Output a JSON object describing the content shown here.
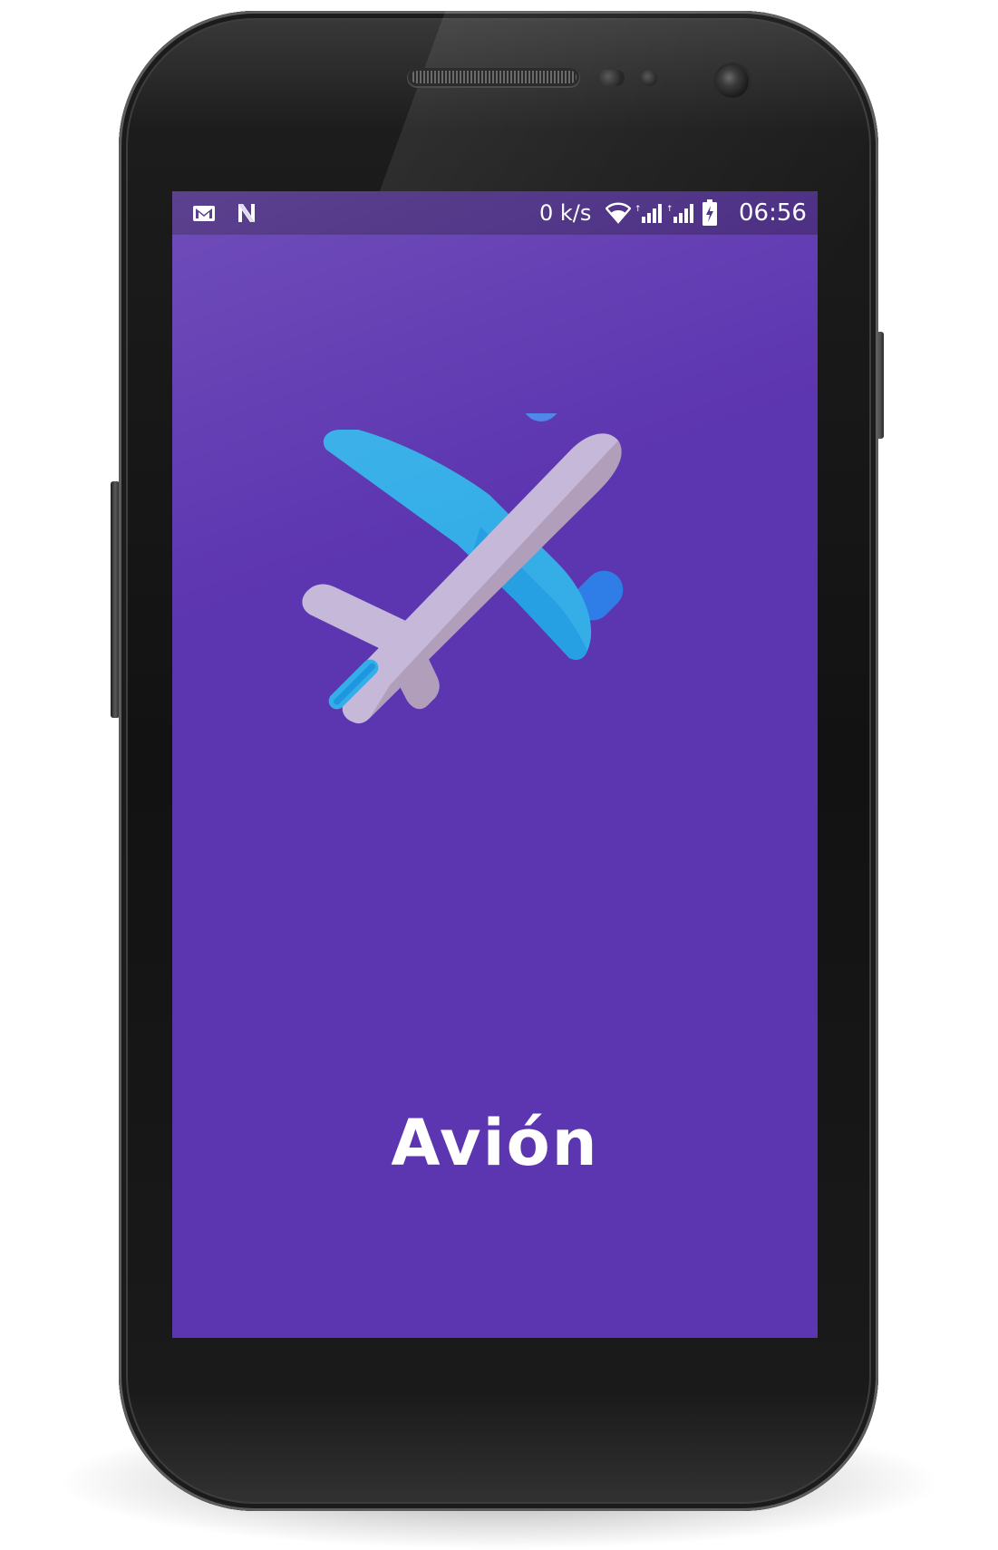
{
  "status_bar": {
    "notification_icons": [
      "gmail-icon",
      "n-icon"
    ],
    "network_speed": "0 k/s",
    "system_icons": [
      "wifi-icon",
      "signal-icon",
      "signal-icon",
      "battery-charging-icon"
    ],
    "time": "06:56",
    "background_color": "#45277f"
  },
  "splash": {
    "logo_icon": "airplane-icon",
    "app_name": "Avión",
    "background_color": "#5c35b0",
    "logo_colors": {
      "fuselage": "#c5b8d8",
      "fuselage_shade": "#b09ebb",
      "wings": "#35aee8",
      "engines": "#3d87ee"
    }
  }
}
